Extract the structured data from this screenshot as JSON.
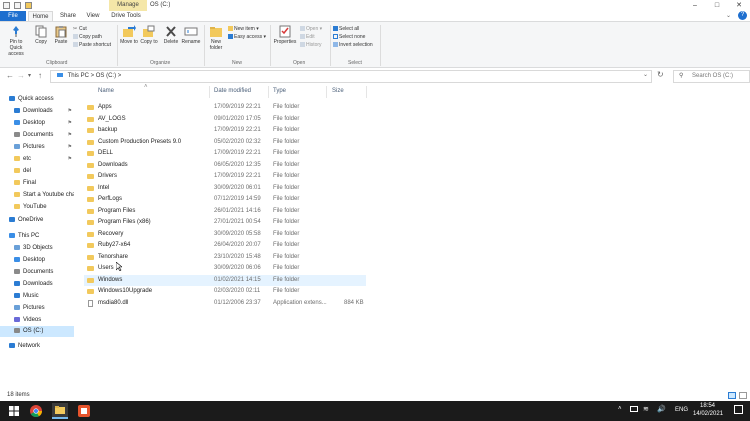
{
  "titlebar": {
    "manage_label": "Manage",
    "window_title": "OS (C:)"
  },
  "ribbon_tabs": {
    "file": "File",
    "home": "Home",
    "share": "Share",
    "view": "View",
    "drive_tools": "Drive Tools"
  },
  "ribbon": {
    "pin_label": "Pin to Quick access",
    "copy_label": "Copy",
    "paste_label": "Paste",
    "cut_label": "Cut",
    "copy_path_label": "Copy path",
    "paste_shortcut_label": "Paste shortcut",
    "clipboard_group": "Clipboard",
    "move_to_label": "Move to",
    "copy_to_label": "Copy to",
    "delete_label": "Delete",
    "rename_label": "Rename",
    "organize_group": "Organize",
    "new_folder_label": "New folder",
    "new_item_label": "New item",
    "easy_access_label": "Easy access",
    "new_group": "New",
    "properties_label": "Properties",
    "open_label": "Open",
    "edit_label": "Edit",
    "history_label": "History",
    "open_group": "Open",
    "select_all_label": "Select all",
    "select_none_label": "Select none",
    "invert_selection_label": "Invert selection",
    "select_group": "Select"
  },
  "address": {
    "path": "This PC  >  OS (C:)  >",
    "search_placeholder": "Search OS (C:)"
  },
  "nav": [
    {
      "label": "Quick access",
      "icon": "star-icon",
      "color": "#2b7cd3",
      "pinned": false
    },
    {
      "label": "Downloads",
      "icon": "download-icon",
      "color": "#2b7cd3",
      "pinned": true
    },
    {
      "label": "Desktop",
      "icon": "desktop-icon",
      "color": "#3a8ee6",
      "pinned": true
    },
    {
      "label": "Documents",
      "icon": "documents-icon",
      "color": "#8a8a8a",
      "pinned": true
    },
    {
      "label": "Pictures",
      "icon": "pictures-icon",
      "color": "#6aa0d8",
      "pinned": true
    },
    {
      "label": "etc",
      "icon": "folder-icon",
      "color": "#f2c95c",
      "pinned": true
    },
    {
      "label": "del",
      "icon": "folder-icon",
      "color": "#f2c95c",
      "pinned": false
    },
    {
      "label": "Final",
      "icon": "folder-icon",
      "color": "#f2c95c",
      "pinned": false
    },
    {
      "label": "Start a Youtube cha",
      "icon": "folder-icon",
      "color": "#f2c95c",
      "pinned": false
    },
    {
      "label": "YouTube",
      "icon": "folder-icon",
      "color": "#f2c95c",
      "pinned": false
    },
    {
      "label": "OneDrive",
      "icon": "cloud-icon",
      "color": "#2b7cd3",
      "pinned": false
    },
    {
      "label": "This PC",
      "icon": "computer-icon",
      "color": "#3a8ee6",
      "pinned": false
    },
    {
      "label": "3D Objects",
      "icon": "cube-icon",
      "color": "#6aa0d8",
      "pinned": false
    },
    {
      "label": "Desktop",
      "icon": "desktop-icon",
      "color": "#3a8ee6",
      "pinned": false
    },
    {
      "label": "Documents",
      "icon": "documents-icon",
      "color": "#8a8a8a",
      "pinned": false
    },
    {
      "label": "Downloads",
      "icon": "download-icon",
      "color": "#2b7cd3",
      "pinned": false
    },
    {
      "label": "Music",
      "icon": "music-icon",
      "color": "#2b7cd3",
      "pinned": false
    },
    {
      "label": "Pictures",
      "icon": "pictures-icon",
      "color": "#6aa0d8",
      "pinned": false
    },
    {
      "label": "Videos",
      "icon": "videos-icon",
      "color": "#6a6ad8",
      "pinned": false
    },
    {
      "label": "OS (C:)",
      "icon": "drive-icon",
      "color": "#888888",
      "pinned": false
    },
    {
      "label": "Network",
      "icon": "network-icon",
      "color": "#2b7cd3",
      "pinned": false
    }
  ],
  "columns": {
    "name": "Name",
    "date": "Date modified",
    "type": "Type",
    "size": "Size"
  },
  "files": [
    {
      "name": "Apps",
      "date": "17/09/2019 22:21",
      "type": "File folder",
      "size": "",
      "kind": "folder"
    },
    {
      "name": "AV_LOGS",
      "date": "09/01/2020 17:05",
      "type": "File folder",
      "size": "",
      "kind": "folder"
    },
    {
      "name": "backup",
      "date": "17/09/2019 22:21",
      "type": "File folder",
      "size": "",
      "kind": "folder"
    },
    {
      "name": "Custom Production Presets 9.0",
      "date": "05/02/2020 02:32",
      "type": "File folder",
      "size": "",
      "kind": "folder"
    },
    {
      "name": "DELL",
      "date": "17/09/2019 22:21",
      "type": "File folder",
      "size": "",
      "kind": "folder"
    },
    {
      "name": "Downloads",
      "date": "06/05/2020 12:35",
      "type": "File folder",
      "size": "",
      "kind": "folder"
    },
    {
      "name": "Drivers",
      "date": "17/09/2019 22:21",
      "type": "File folder",
      "size": "",
      "kind": "folder"
    },
    {
      "name": "Intel",
      "date": "30/09/2020 06:01",
      "type": "File folder",
      "size": "",
      "kind": "folder"
    },
    {
      "name": "PerfLogs",
      "date": "07/12/2019 14:59",
      "type": "File folder",
      "size": "",
      "kind": "folder"
    },
    {
      "name": "Program Files",
      "date": "26/01/2021 14:16",
      "type": "File folder",
      "size": "",
      "kind": "folder"
    },
    {
      "name": "Program Files (x86)",
      "date": "27/01/2021 00:54",
      "type": "File folder",
      "size": "",
      "kind": "folder"
    },
    {
      "name": "Recovery",
      "date": "30/09/2020 05:58",
      "type": "File folder",
      "size": "",
      "kind": "folder"
    },
    {
      "name": "Ruby27-x64",
      "date": "26/04/2020 20:07",
      "type": "File folder",
      "size": "",
      "kind": "folder"
    },
    {
      "name": "Tenorshare",
      "date": "23/10/2020 15:48",
      "type": "File folder",
      "size": "",
      "kind": "folder"
    },
    {
      "name": "Users",
      "date": "30/09/2020 06:06",
      "type": "File folder",
      "size": "",
      "kind": "folder"
    },
    {
      "name": "Windows",
      "date": "01/02/2021 14:15",
      "type": "File folder",
      "size": "",
      "kind": "folder",
      "selected": true
    },
    {
      "name": "Windows10Upgrade",
      "date": "02/03/2020 02:11",
      "type": "File folder",
      "size": "",
      "kind": "folder"
    },
    {
      "name": "msdia80.dll",
      "date": "01/12/2006 23:37",
      "type": "Application extens...",
      "size": "884 KB",
      "kind": "file"
    }
  ],
  "status": {
    "item_count": "18 items"
  },
  "taskbar": {
    "lang": "ENG",
    "time": "18:54",
    "date": "14/02/2021"
  }
}
